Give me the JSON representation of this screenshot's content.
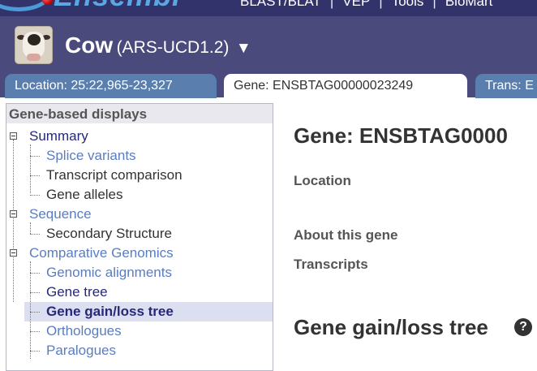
{
  "masthead": {
    "logo_text": "Ensembl",
    "tools": [
      "BLAST/BLAT",
      "VEP",
      "Tools",
      "BioMart"
    ]
  },
  "species": {
    "name": "Cow",
    "assembly": "(ARS-UCD1.2)",
    "dropdown_glyph": "▼",
    "icon": "cow-species-icon"
  },
  "tabs": {
    "location": "Location: 25:22,965-23,327",
    "gene": "Gene: ENSBTAG00000023249",
    "trans": "Trans: E"
  },
  "nav": {
    "header": "Gene-based displays",
    "items": [
      {
        "label": "Summary"
      },
      {
        "label": "Splice variants"
      },
      {
        "label": "Transcript comparison"
      },
      {
        "label": "Gene alleles"
      },
      {
        "label": "Sequence"
      },
      {
        "label": "Secondary Structure"
      },
      {
        "label": "Comparative Genomics"
      },
      {
        "label": "Genomic alignments"
      },
      {
        "label": "Gene tree"
      },
      {
        "label": "Gene gain/loss tree"
      },
      {
        "label": "Orthologues"
      },
      {
        "label": "Paralogues"
      }
    ]
  },
  "main": {
    "title": "Gene: ENSBTAG0000",
    "summary_labels": [
      "Location",
      "About this gene",
      "Transcripts"
    ],
    "section_title": "Gene gain/loss tree",
    "help_glyph": "?"
  },
  "colors": {
    "masthead": "#33336b",
    "species_bar": "#4a4a7c",
    "inactive_tab": "#5a7fae",
    "active_nav_bg": "#dcdff0",
    "link_dark": "#27277a",
    "link_light": "#5a7dc0"
  }
}
